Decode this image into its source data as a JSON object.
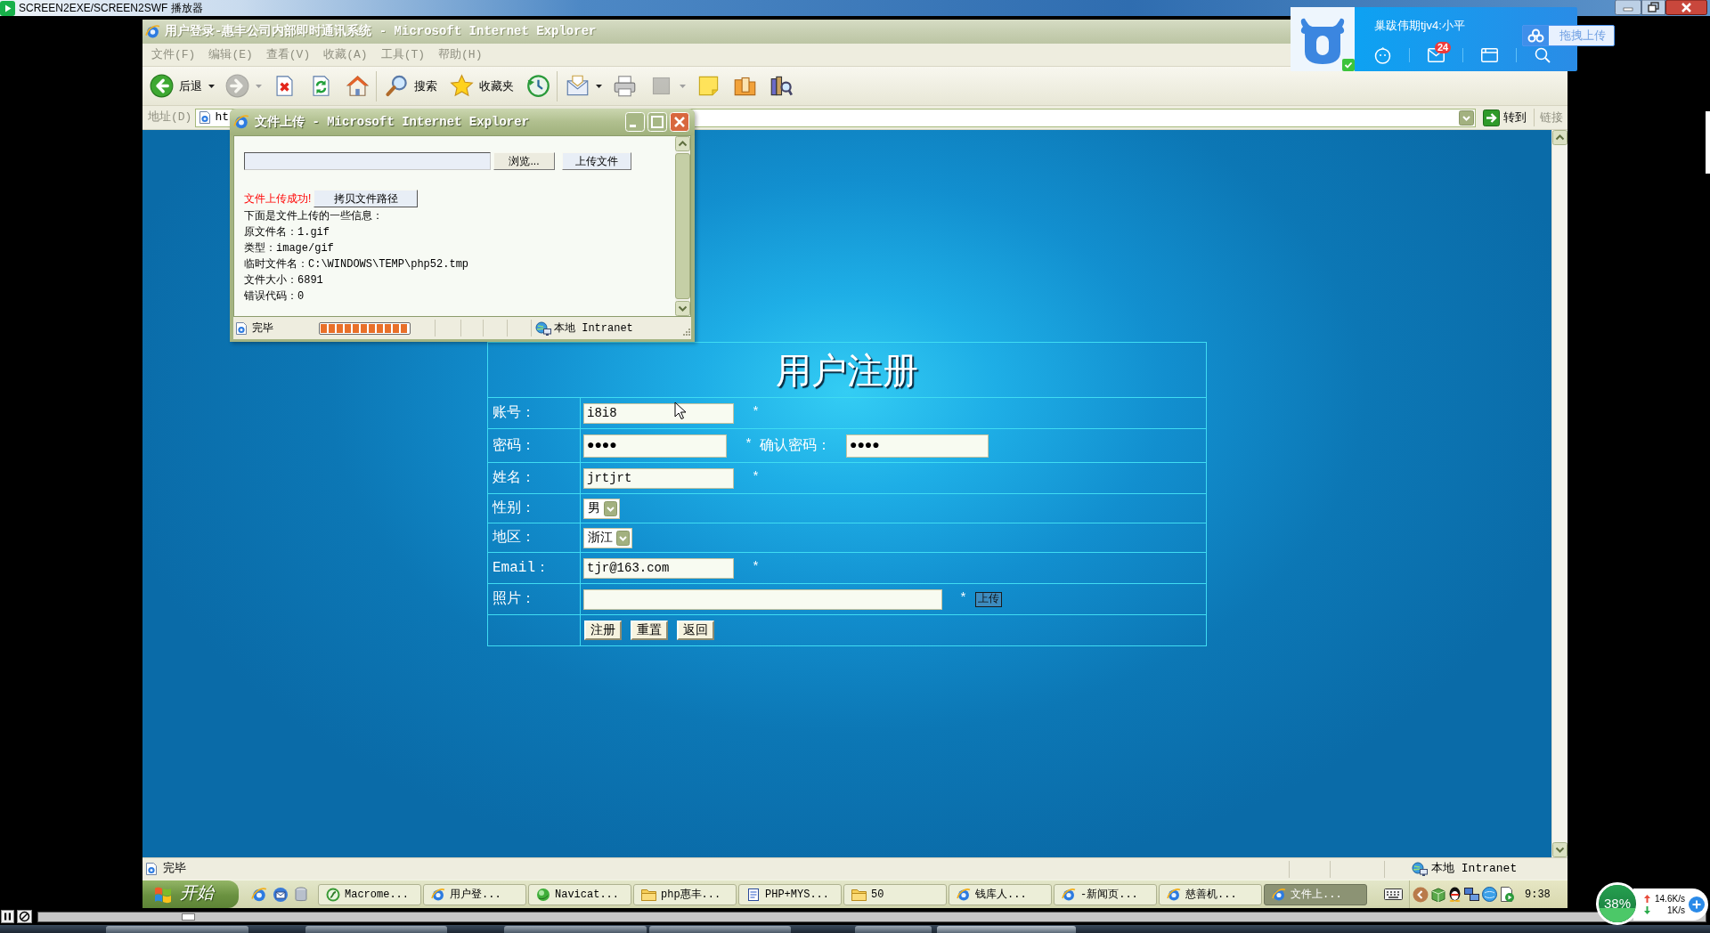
{
  "player": {
    "title": "SCREEN2EXE/SCREEN2SWF 播放器",
    "seek": {
      "level": 0.09
    }
  },
  "browser": {
    "title": "用户登录-惠丰公司内部即时通讯系统 - Microsoft Internet Explorer",
    "menu": [
      "文件(F)",
      "编辑(E)",
      "查看(V)",
      "收藏(A)",
      "工具(T)",
      "帮助(H)"
    ],
    "toolbar": [
      [
        {
          "kind": "back",
          "label": "后退",
          "dropdown": true,
          "disabled": false
        },
        {
          "kind": "forward",
          "dropdown": true,
          "disabled": true
        },
        {
          "kind": "stop",
          "dropdown": false,
          "disabled": false
        },
        {
          "kind": "refresh",
          "dropdown": false,
          "disabled": false
        },
        {
          "kind": "home",
          "dropdown": false,
          "disabled": false
        }
      ],
      [
        {
          "kind": "search",
          "label": "搜索",
          "dropdown": false,
          "disabled": false
        },
        {
          "kind": "favorites",
          "label": "收藏夹",
          "dropdown": false,
          "disabled": false
        },
        {
          "kind": "history",
          "dropdown": false,
          "disabled": false
        }
      ],
      [
        {
          "kind": "mail",
          "dropdown": true,
          "disabled": false
        },
        {
          "kind": "print",
          "dropdown": false,
          "disabled": false
        },
        {
          "kind": "edit",
          "dropdown": true,
          "disabled": true
        },
        {
          "kind": "notes",
          "dropdown": false,
          "disabled": false
        },
        {
          "kind": "folders",
          "dropdown": false,
          "disabled": false
        },
        {
          "kind": "research",
          "dropdown": false,
          "disabled": false
        }
      ]
    ],
    "address": {
      "label": "地址(D)",
      "value": "ht",
      "go": "转到",
      "links": "链接"
    },
    "status": {
      "text": "完毕",
      "zone": "本地 Intranet"
    }
  },
  "form": {
    "title": "用户注册",
    "rows": [
      {
        "kind": "text",
        "label": "账号：",
        "value": "i8i8",
        "note": "*"
      },
      {
        "kind": "password",
        "label": "密码：",
        "value": "●●●●",
        "note": "*",
        "confirm_label": "确认密码：",
        "confirm_value": "●●●●"
      },
      {
        "kind": "text",
        "label": "姓名：",
        "value": "jrtjrt",
        "note": "*"
      },
      {
        "kind": "select",
        "label": "性别：",
        "value": "男"
      },
      {
        "kind": "select",
        "label": "地区：",
        "value": "浙江"
      },
      {
        "kind": "text",
        "label": "Email：",
        "value": "tjr@163.com",
        "note": "*"
      },
      {
        "kind": "file",
        "label": "照片：",
        "note": "*",
        "button": "上传"
      }
    ],
    "buttons": [
      "注册",
      "重置",
      "返回"
    ]
  },
  "popup": {
    "title": "文件上传 - Microsoft Internet Explorer",
    "browse": "浏览...",
    "upload": "上传文件",
    "message": "文件上传成功!",
    "copy": "拷贝文件路径",
    "lines": [
      "下面是文件上传的一些信息：",
      "原文件名：1.gif",
      "类型：image/gif",
      "临时文件名：C:\\WINDOWS\\TEMP\\php52.tmp",
      "文件大小：6891",
      "错误代码：0"
    ],
    "status": {
      "text": "完毕",
      "progress": {
        "level": 1
      },
      "zone": "本地 Intranet"
    }
  },
  "taskbar": {
    "start": "开始",
    "tasks": [
      {
        "kind": "flash",
        "label": "Macrome...",
        "selected": false
      },
      {
        "kind": "browser",
        "label": "用户登...",
        "selected": false
      },
      {
        "kind": "navicat",
        "label": "Navicat...",
        "selected": false
      },
      {
        "kind": "folder",
        "label": "php惠丰...",
        "selected": false
      },
      {
        "kind": "word",
        "label": "PHP+MYS...",
        "selected": false
      },
      {
        "kind": "folder",
        "label": "50",
        "selected": false
      },
      {
        "kind": "browser",
        "label": "钱库人...",
        "selected": false
      },
      {
        "kind": "browser",
        "label": "-新闻页...",
        "selected": false
      },
      {
        "kind": "browser",
        "label": "慈善机...",
        "selected": false
      },
      {
        "kind": "browser",
        "label": "文件上...",
        "selected": true
      }
    ],
    "time": "9:38"
  },
  "messenger": {
    "name": "巢跋伟期tjv4:小平",
    "badge": "24",
    "upload": "拖拽上传"
  },
  "net_monitor": {
    "usage": "38%",
    "level": 0.38,
    "upload": "14.6K/s",
    "download": "1K/s"
  }
}
